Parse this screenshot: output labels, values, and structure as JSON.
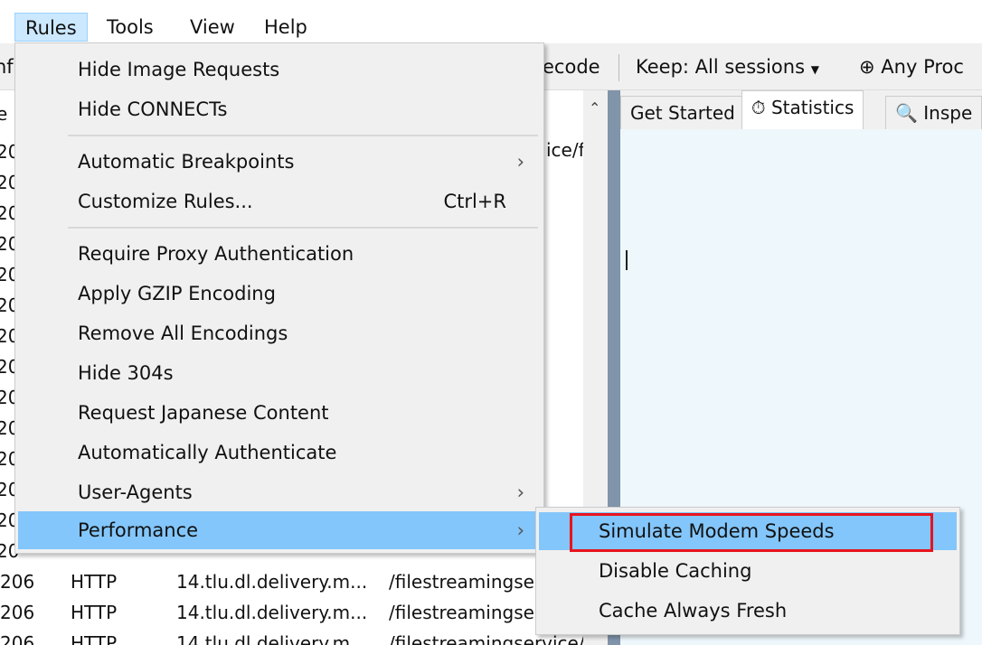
{
  "menubar": {
    "items": [
      "Rules",
      "Tools",
      "View",
      "Help"
    ]
  },
  "toolbar": {
    "left_fragment": "nf",
    "decode_fragment": "ecode",
    "keep": "Keep: All sessions",
    "process": "Any Proc"
  },
  "list": {
    "header_fragment": "e",
    "rows_partial": [
      "20",
      "20",
      "20",
      "20",
      "20",
      "20",
      "20",
      "20",
      "20",
      "20",
      "20",
      "20",
      "20",
      "20"
    ],
    "right_fragment": "ice/f",
    "rows": [
      {
        "result": "206",
        "protocol": "HTTP",
        "host": "14.tlu.dl.delivery.m...",
        "url": "/filestreamingser"
      },
      {
        "result": "206",
        "protocol": "HTTP",
        "host": "14.tlu.dl.delivery.m...",
        "url": "/filestreamingser"
      },
      {
        "result": "206",
        "protocol": "HTTP",
        "host": "14.tlu.dl.delivery.m...",
        "url": "/filestreamingservice/f"
      }
    ]
  },
  "tabs": [
    "Get Started",
    "Statistics",
    "Inspe"
  ],
  "rules_menu": {
    "items": [
      {
        "label": "Hide Image Requests"
      },
      {
        "label": "Hide CONNECTs"
      },
      {
        "label": "Automatic Breakpoints",
        "submenu": true
      },
      {
        "label": "Customize Rules...",
        "shortcut": "Ctrl+R"
      },
      {
        "label": "Require Proxy Authentication"
      },
      {
        "label": "Apply GZIP Encoding"
      },
      {
        "label": "Remove All Encodings"
      },
      {
        "label": "Hide 304s"
      },
      {
        "label": "Request Japanese Content"
      },
      {
        "label": "Automatically Authenticate"
      },
      {
        "label": "User-Agents",
        "submenu": true
      },
      {
        "label": "Performance",
        "submenu": true,
        "highlighted": true
      }
    ],
    "arrow": "›"
  },
  "performance_submenu": {
    "items": [
      "Simulate Modem Speeds",
      "Disable Caching",
      "Cache Always Fresh"
    ],
    "highlighted": "Simulate Modem Speeds"
  },
  "colors": {
    "highlight": "#83c6fb",
    "annotation": "#e8141e",
    "menubar_active": "#cce8ff"
  }
}
